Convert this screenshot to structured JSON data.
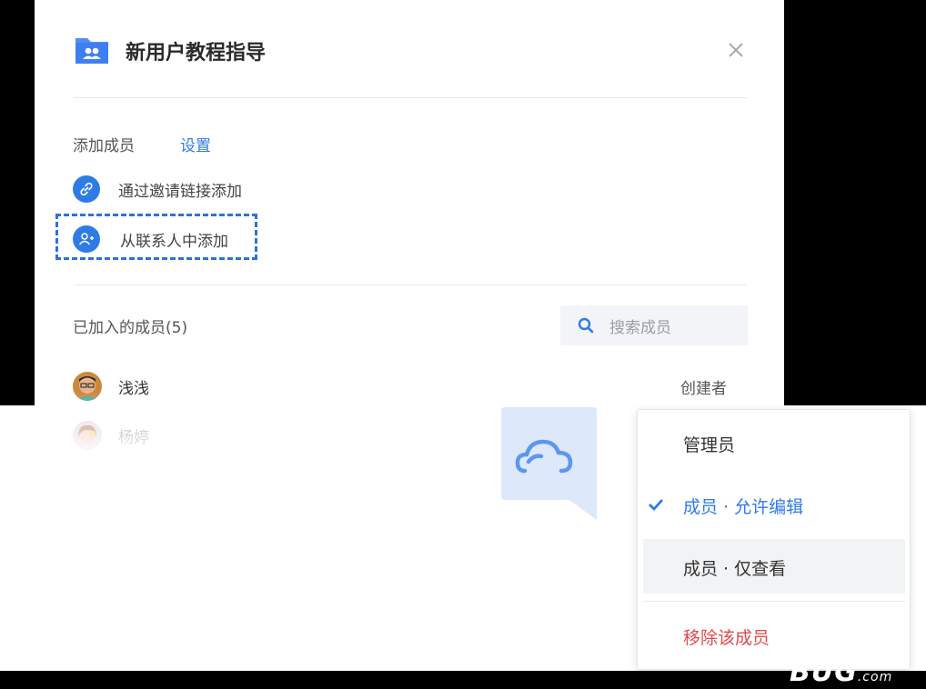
{
  "dialog": {
    "title": "新用户教程指导",
    "tabs": {
      "add_members": "添加成员",
      "settings": "设置"
    },
    "actions": [
      {
        "label": "通过邀请链接添加",
        "icon": "link-icon"
      },
      {
        "label": "从联系人中添加",
        "icon": "add-user-icon"
      }
    ],
    "joined_label": "已加入的成员(5)",
    "search_placeholder": "搜索成员",
    "members": [
      {
        "name": "浅浅",
        "role": "创建者",
        "avatar": "avatar-male"
      },
      {
        "name": "杨婷",
        "role": "",
        "avatar": "avatar-female"
      }
    ]
  },
  "role_menu": {
    "items": [
      {
        "label": "管理员",
        "selected": false
      },
      {
        "label": "成员 · 允许编辑",
        "selected": true
      },
      {
        "label": "成员 · 仅查看",
        "selected": false,
        "hovered": true
      }
    ],
    "danger_item": "移除该成员"
  },
  "colors": {
    "accent": "#2f7be6",
    "danger": "#e5484d",
    "highlight_dash": "#2f6fe0"
  },
  "watermark": {
    "main": "BUG",
    "suffix": ".com"
  }
}
